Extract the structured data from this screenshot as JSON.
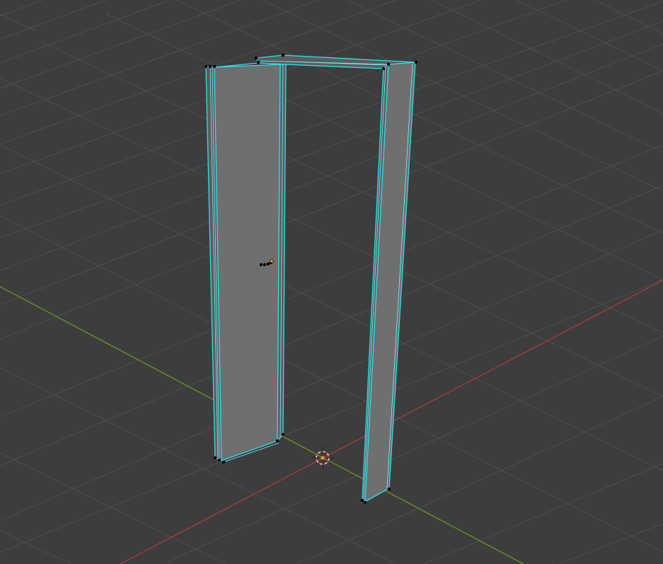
{
  "viewport": {
    "mode": "edit-mode-3d-viewport",
    "background_color": "#3d3d3d",
    "grid_color": "#4f4f4f",
    "x_axis_color": "#a23a45",
    "y_axis_color": "#6b8e23",
    "selection_color": "#25e4f2",
    "face_color": "#6f6f6f"
  },
  "icons": {
    "cursor": "3d-cursor-icon",
    "origin": "object-origin-icon"
  }
}
